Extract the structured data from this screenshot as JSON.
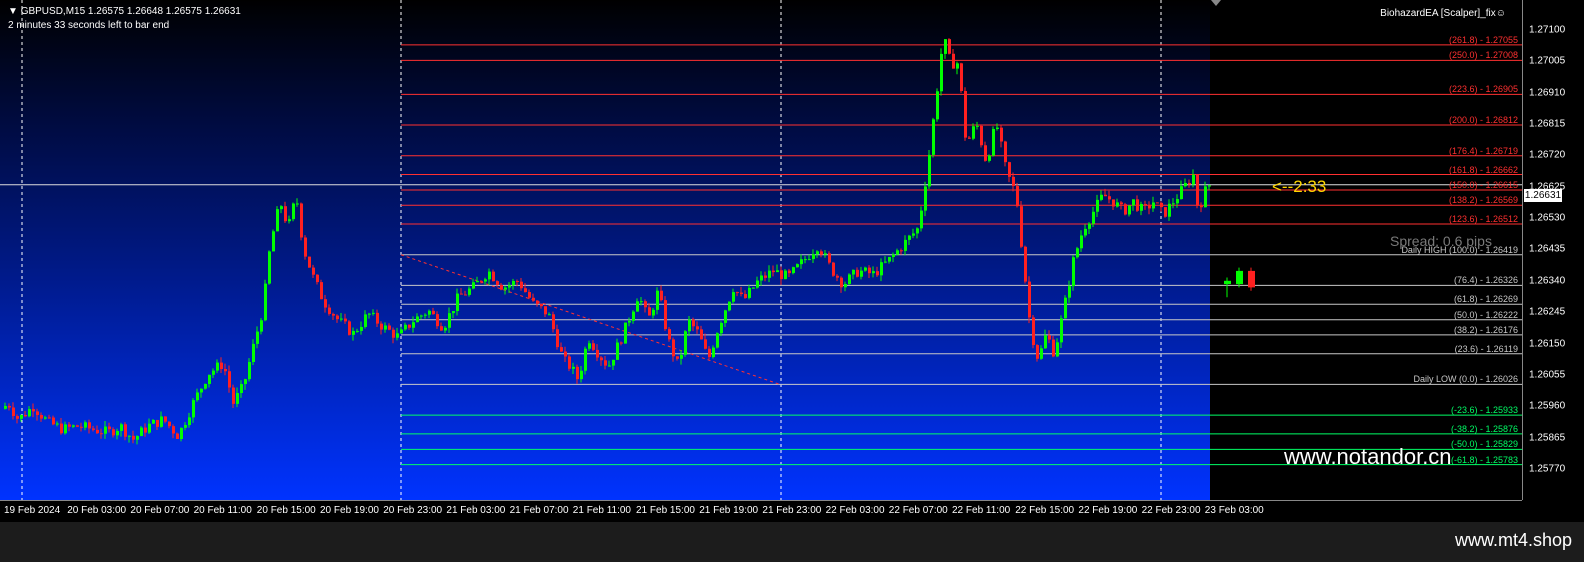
{
  "chart_info": {
    "symbol_line": "GBPUSD,M15  1.26575  1.26648  1.26575  1.26631",
    "countdown": "2 minutes 33 seconds left to bar end",
    "ea_name": "BiohazardEA [Scalper]_fix",
    "timer": "<--2:33",
    "spread": "Spread: 0.6 pips",
    "watermark": "www.notandor.cn",
    "footer_brand": "www.mt4.shop",
    "current_price": "1.26631"
  },
  "colors": {
    "bull": "#00ff00",
    "bear": "#ff2020",
    "fib_red": "#ff3030",
    "fib_white": "#c8c8c8",
    "fib_green": "#00ff66",
    "timer": "#ffd700"
  },
  "price_axis": [
    "1.27100",
    "1.27005",
    "1.26910",
    "1.26815",
    "1.26720",
    "1.26625",
    "1.26530",
    "1.26435",
    "1.26340",
    "1.26245",
    "1.26150",
    "1.26055",
    "1.25960",
    "1.25865",
    "1.25770"
  ],
  "time_axis": [
    "19 Feb 2024",
    "20 Feb 03:00",
    "20 Feb 07:00",
    "20 Feb 11:00",
    "20 Feb 15:00",
    "20 Feb 19:00",
    "20 Feb 23:00",
    "21 Feb 03:00",
    "21 Feb 07:00",
    "21 Feb 11:00",
    "21 Feb 15:00",
    "21 Feb 19:00",
    "21 Feb 23:00",
    "22 Feb 03:00",
    "22 Feb 07:00",
    "22 Feb 11:00",
    "22 Feb 15:00",
    "22 Feb 19:00",
    "22 Feb 23:00",
    "23 Feb 03:00"
  ],
  "fib_levels": [
    {
      "label": "(261.8) - 1.27055",
      "price": 1.27055,
      "zone": "red"
    },
    {
      "label": "(250.0) - 1.27008",
      "price": 1.27008,
      "zone": "red"
    },
    {
      "label": "(223.6) - 1.26905",
      "price": 1.26905,
      "zone": "red"
    },
    {
      "label": "(200.0) - 1.26812",
      "price": 1.26812,
      "zone": "red"
    },
    {
      "label": "(176.4) - 1.26719",
      "price": 1.26719,
      "zone": "red"
    },
    {
      "label": "(161.8) - 1.26662",
      "price": 1.26662,
      "zone": "red"
    },
    {
      "label": "(150.0) - 1.26615",
      "price": 1.26615,
      "zone": "red"
    },
    {
      "label": "(138.2) - 1.26569",
      "price": 1.26569,
      "zone": "red"
    },
    {
      "label": "(123.6) - 1.26512",
      "price": 1.26512,
      "zone": "red"
    },
    {
      "label": "Daily HIGH (100.0) - 1.26419",
      "price": 1.26419,
      "zone": "white"
    },
    {
      "label": "(76.4) - 1.26326",
      "price": 1.26326,
      "zone": "white"
    },
    {
      "label": "(61.8) - 1.26269",
      "price": 1.26269,
      "zone": "white"
    },
    {
      "label": "(50.0) - 1.26222",
      "price": 1.26222,
      "zone": "white"
    },
    {
      "label": "(38.2) - 1.26176",
      "price": 1.26176,
      "zone": "white"
    },
    {
      "label": "(23.6) - 1.26119",
      "price": 1.26119,
      "zone": "white"
    },
    {
      "label": "Daily LOW (0.0) - 1.26026",
      "price": 1.26026,
      "zone": "white"
    },
    {
      "label": "(-23.6) - 1.25933",
      "price": 1.25933,
      "zone": "green"
    },
    {
      "label": "(-38.2) - 1.25876",
      "price": 1.25876,
      "zone": "green"
    },
    {
      "label": "(-50.0) - 1.25829",
      "price": 1.25829,
      "zone": "green"
    },
    {
      "label": "(-61.8) - 1.25783",
      "price": 1.25783,
      "zone": "green"
    }
  ],
  "chart_data": {
    "type": "candlestick",
    "symbol": "GBPUSD",
    "timeframe": "M15",
    "y_range": [
      1.2574,
      1.2718
    ],
    "current_bid": 1.26631,
    "path_points": [
      [
        0,
        1.2594
      ],
      [
        10,
        1.2597
      ],
      [
        20,
        1.2592
      ],
      [
        35,
        1.2596
      ],
      [
        50,
        1.2591
      ],
      [
        65,
        1.2589
      ],
      [
        80,
        1.259
      ],
      [
        95,
        1.2589
      ],
      [
        110,
        1.2588
      ],
      [
        122,
        1.259
      ],
      [
        135,
        1.2586
      ],
      [
        150,
        1.259
      ],
      [
        165,
        1.2592
      ],
      [
        180,
        1.2587
      ],
      [
        195,
        1.2597
      ],
      [
        210,
        1.2606
      ],
      [
        225,
        1.2609
      ],
      [
        235,
        1.2597
      ],
      [
        245,
        1.2602
      ],
      [
        255,
        1.2614
      ],
      [
        265,
        1.2626
      ],
      [
        272,
        1.2645
      ],
      [
        282,
        1.2658
      ],
      [
        290,
        1.265
      ],
      [
        298,
        1.266
      ],
      [
        305,
        1.2644
      ],
      [
        315,
        1.2635
      ],
      [
        325,
        1.2628
      ],
      [
        340,
        1.2622
      ],
      [
        355,
        1.2618
      ],
      [
        370,
        1.2624
      ],
      [
        385,
        1.262
      ],
      [
        400,
        1.2617
      ],
      [
        415,
        1.2622
      ],
      [
        430,
        1.2625
      ],
      [
        445,
        1.262
      ],
      [
        460,
        1.2629
      ],
      [
        475,
        1.2632
      ],
      [
        490,
        1.2637
      ],
      [
        505,
        1.2632
      ],
      [
        520,
        1.2634
      ],
      [
        535,
        1.2627
      ],
      [
        550,
        1.2624
      ],
      [
        565,
        1.261
      ],
      [
        572,
        1.2608
      ],
      [
        580,
        1.2604
      ],
      [
        590,
        1.2617
      ],
      [
        600,
        1.2612
      ],
      [
        610,
        1.2608
      ],
      [
        625,
        1.2618
      ],
      [
        640,
        1.263
      ],
      [
        650,
        1.2622
      ],
      [
        660,
        1.2631
      ],
      [
        670,
        1.2616
      ],
      [
        680,
        1.2608
      ],
      [
        690,
        1.2622
      ],
      [
        700,
        1.2618
      ],
      [
        710,
        1.261
      ],
      [
        720,
        1.262
      ],
      [
        735,
        1.2632
      ],
      [
        745,
        1.2628
      ],
      [
        760,
        1.2634
      ],
      [
        775,
        1.2637
      ],
      [
        790,
        1.2635
      ],
      [
        805,
        1.264
      ],
      [
        820,
        1.2645
      ],
      [
        832,
        1.2638
      ],
      [
        845,
        1.2633
      ],
      [
        860,
        1.2637
      ],
      [
        875,
        1.2636
      ],
      [
        890,
        1.264
      ],
      [
        905,
        1.2645
      ],
      [
        920,
        1.265
      ],
      [
        930,
        1.267
      ],
      [
        938,
        1.269
      ],
      [
        945,
        1.2708
      ],
      [
        952,
        1.27
      ],
      [
        960,
        1.27
      ],
      [
        968,
        1.2675
      ],
      [
        978,
        1.2682
      ],
      [
        988,
        1.267
      ],
      [
        998,
        1.2682
      ],
      [
        1008,
        1.2667
      ],
      [
        1018,
        1.266
      ],
      [
        1025,
        1.264
      ],
      [
        1032,
        1.262
      ],
      [
        1040,
        1.261
      ],
      [
        1048,
        1.2618
      ],
      [
        1056,
        1.2612
      ],
      [
        1066,
        1.2626
      ],
      [
        1075,
        1.264
      ],
      [
        1085,
        1.265
      ],
      [
        1095,
        1.2655
      ],
      [
        1105,
        1.266
      ],
      [
        1115,
        1.2658
      ],
      [
        1125,
        1.2655
      ],
      [
        1135,
        1.2658
      ],
      [
        1145,
        1.2655
      ],
      [
        1155,
        1.2658
      ],
      [
        1165,
        1.2654
      ],
      [
        1175,
        1.2658
      ],
      [
        1185,
        1.2662
      ],
      [
        1195,
        1.2666
      ],
      [
        1200,
        1.2655
      ],
      [
        1205,
        1.266
      ],
      [
        1210,
        1.2663
      ]
    ],
    "mini_candles": [
      {
        "o": 1.2633,
        "h": 1.2635,
        "l": 1.2629,
        "c": 1.2634
      },
      {
        "o": 1.2633,
        "h": 1.2638,
        "l": 1.2632,
        "c": 1.2637
      },
      {
        "o": 1.2637,
        "h": 1.2638,
        "l": 1.2631,
        "c": 1.2632
      }
    ]
  }
}
